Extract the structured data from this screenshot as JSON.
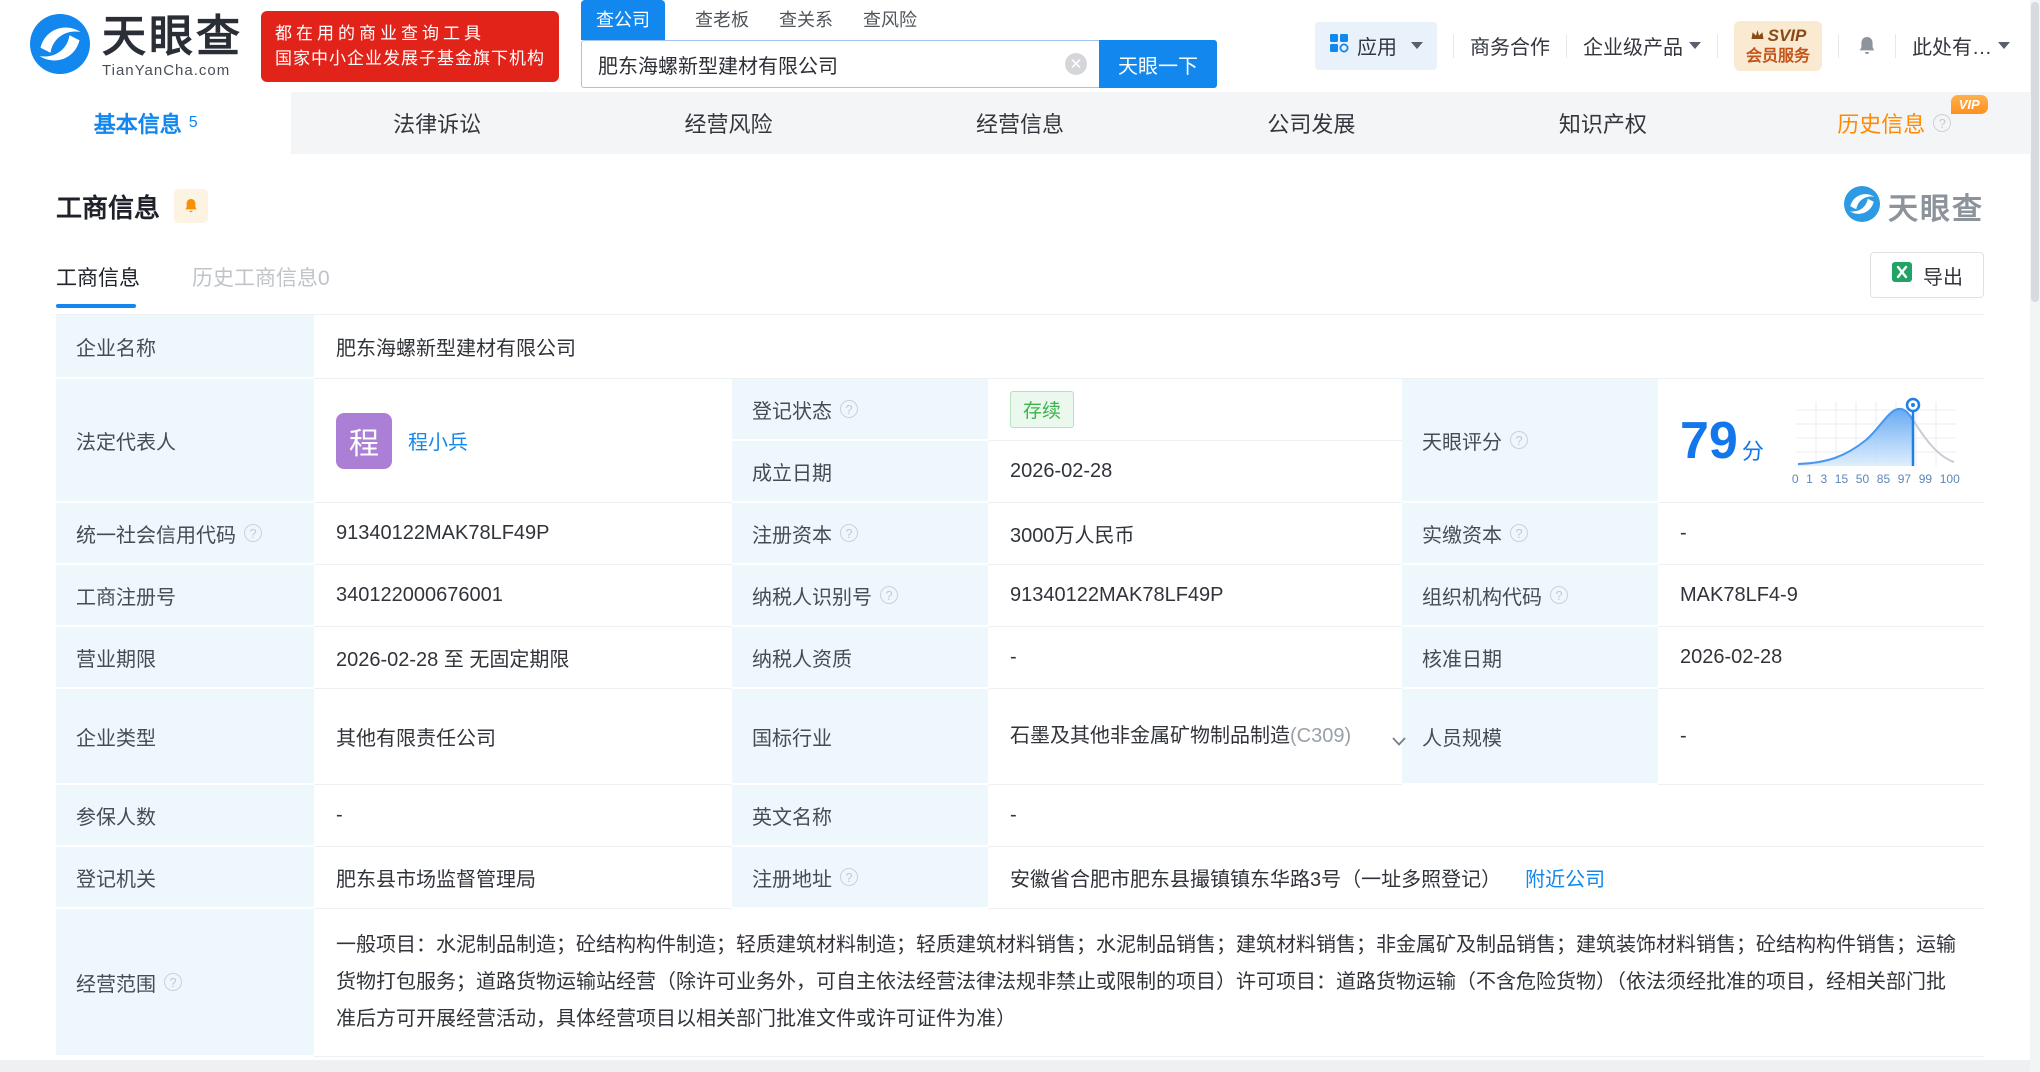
{
  "brand": {
    "logo_text": "天眼查",
    "logo_sub": "TianYanCha.com",
    "banner_line1": "都在用的商业查询工具",
    "banner_line2": "国家中小企业发展子基金旗下机构"
  },
  "search": {
    "tabs": [
      {
        "label": "查公司"
      },
      {
        "label": "查老板"
      },
      {
        "label": "查关系"
      },
      {
        "label": "查风险"
      }
    ],
    "value": "肥东海螺新型建材有限公司",
    "button": "天眼一下"
  },
  "top_nav": {
    "apps": "应用",
    "business": "商务合作",
    "enterprise": "企业级产品",
    "svip_line1": "SVIP",
    "svip_line2": "会员服务",
    "more": "此处有…"
  },
  "tabs": {
    "items": [
      {
        "label": "基本信息",
        "count": "5"
      },
      {
        "label": "法律诉讼"
      },
      {
        "label": "经营风险"
      },
      {
        "label": "经营信息"
      },
      {
        "label": "公司发展"
      },
      {
        "label": "知识产权"
      },
      {
        "label": "历史信息",
        "vip": "VIP"
      }
    ]
  },
  "section": {
    "title": "工商信息",
    "watermark": "天眼查",
    "subtab_active": "工商信息",
    "subtab_history": "历史工商信息0",
    "export_label": "导出"
  },
  "table": {
    "company_name": {
      "label": "企业名称",
      "value": "肥东海螺新型建材有限公司"
    },
    "legal_rep": {
      "label": "法定代表人",
      "avatar": "程",
      "name": "程小兵"
    },
    "reg_status": {
      "label": "登记状态",
      "value": "存续"
    },
    "establish_date": {
      "label": "成立日期",
      "value": "2026-02-28"
    },
    "score": {
      "label": "天眼评分",
      "value": "79",
      "unit": "分",
      "axis": [
        "0",
        "1",
        "3",
        "15",
        "50",
        "85",
        "97",
        "99",
        "100"
      ]
    },
    "credit_code": {
      "label": "统一社会信用代码",
      "value": "91340122MAK78LF49P"
    },
    "reg_capital": {
      "label": "注册资本",
      "value": "3000万人民币"
    },
    "paid_capital": {
      "label": "实缴资本",
      "value": "-"
    },
    "reg_number": {
      "label": "工商注册号",
      "value": "340122000676001"
    },
    "taxpayer_id": {
      "label": "纳税人识别号",
      "value": "91340122MAK78LF49P"
    },
    "org_code": {
      "label": "组织机构代码",
      "value": "MAK78LF4-9"
    },
    "business_term": {
      "label": "营业期限",
      "value": "2026-02-28 至 无固定期限"
    },
    "taxpayer_quality": {
      "label": "纳税人资质",
      "value": "-"
    },
    "approval_date": {
      "label": "核准日期",
      "value": "2026-02-28"
    },
    "company_type": {
      "label": "企业类型",
      "value": "其他有限责任公司"
    },
    "industry": {
      "label": "国标行业",
      "value": "石墨及其他非金属矿物制品制造",
      "code": "(C309)"
    },
    "staff_size": {
      "label": "人员规模",
      "value": "-"
    },
    "insured_count": {
      "label": "参保人数",
      "value": "-"
    },
    "english_name": {
      "label": "英文名称",
      "value": "-"
    },
    "reg_authority": {
      "label": "登记机关",
      "value": "肥东县市场监督管理局"
    },
    "reg_address": {
      "label": "注册地址",
      "value": "安徽省合肥市肥东县撮镇镇东华路3号（一址多照登记）",
      "link": "附近公司"
    },
    "business_scope": {
      "label": "经营范围",
      "value": "一般项目：水泥制品制造；砼结构构件制造；轻质建筑材料制造；轻质建筑材料销售；水泥制品销售；建筑材料销售；非金属矿及制品销售；建筑装饰材料销售；砼结构构件销售；运输货物打包服务；道路货物运输站经营（除许可业务外，可自主依法经营法律法规非禁止或限制的项目）许可项目：道路货物运输（不含危险货物）（依法须经批准的项目，经相关部门批准后方可开展经营活动，具体经营项目以相关部门批准文件或许可证件为准）"
    }
  }
}
